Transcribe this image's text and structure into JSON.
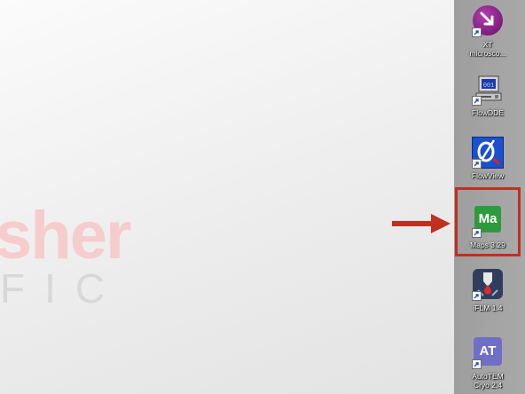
{
  "wallpaper": {
    "brand_text": "sher",
    "sub_text": "FIC",
    "brand_color": "#f6cccc"
  },
  "desktop_icons": [
    {
      "label": "XT\nmicrosco...",
      "icon": "xt-microscope-icon",
      "color": "#8a2a8a"
    },
    {
      "label": "FlowDDE",
      "icon": "flowdde-computer-icon",
      "color": "#2a3a8a"
    },
    {
      "label": "FlowView",
      "icon": "flowview-icon",
      "color": "#1a4fd0"
    },
    {
      "label": "Maps 3.29",
      "icon": "maps-icon",
      "glyph": "Ma",
      "color": "#2e9a3e"
    },
    {
      "label": "iFLM 1.4",
      "icon": "iflm-icon",
      "color": "#2f3e5c"
    },
    {
      "label": "AutoTEM\nCryo 2.4",
      "icon": "autotem-icon",
      "glyph": "AT",
      "color": "#6f6fc8"
    }
  ],
  "annotation": {
    "highlight_color": "#c0301f",
    "target": "Maps 3.29"
  }
}
